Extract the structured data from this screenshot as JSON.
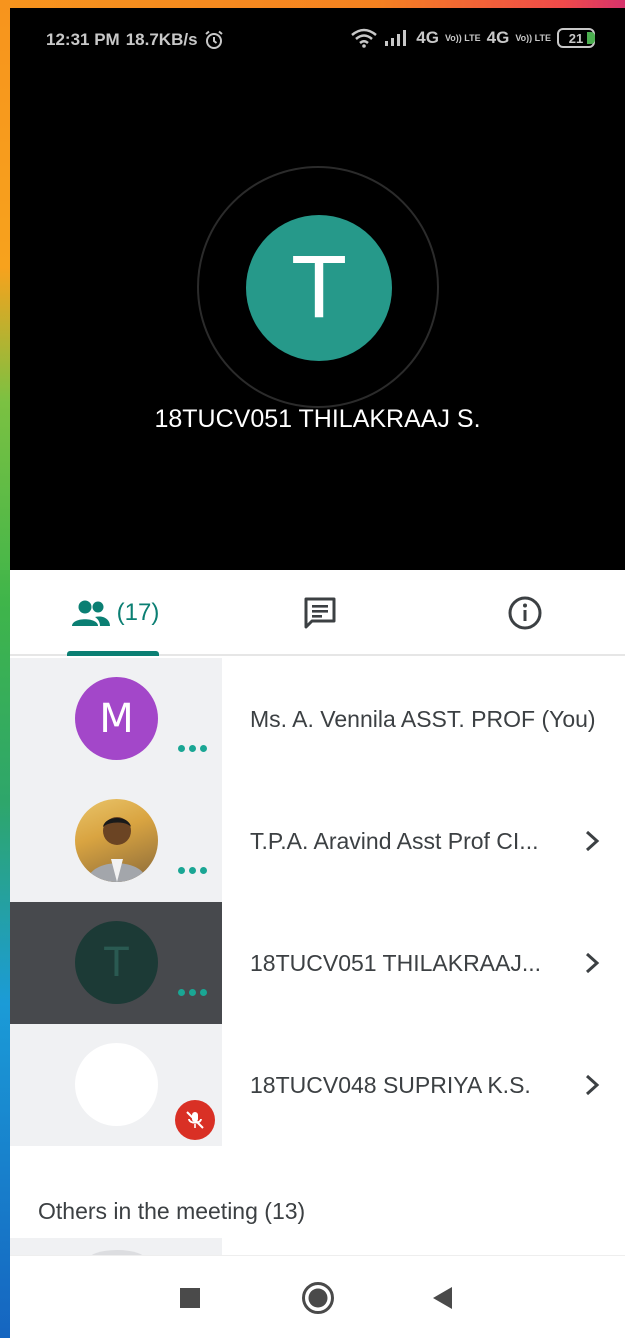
{
  "status_bar": {
    "time": "12:31 PM",
    "speed": "18.7KB/s",
    "net1": "4G",
    "net2": "4G",
    "volte": "Vo)) LTE",
    "battery": "21"
  },
  "main_speaker": {
    "initial": "T",
    "name": "18TUCV051 THILAKRAAJ S.",
    "avatar_color": "#26998a"
  },
  "tabs": {
    "people_count": "(17)",
    "people_icon": "people-icon",
    "chat_icon": "chat-icon",
    "info_icon": "info-icon",
    "accent": "#0b7f73"
  },
  "participants": [
    {
      "initial": "M",
      "name": "Ms. A. Vennila ASST. PROF (You)",
      "avatar": "purple",
      "status": "speaking-dots"
    },
    {
      "initial": "",
      "name": "T.P.A. Aravind Asst Prof CI...",
      "avatar": "photo",
      "status": "speaking-dots"
    },
    {
      "initial": "T",
      "name": "18TUCV051 THILAKRAAJ...",
      "avatar": "dark",
      "status": "speaking-dots"
    },
    {
      "initial": "",
      "name": "18TUCV048 SUPRIYA K.S.",
      "avatar": "white",
      "status": "muted"
    }
  ],
  "others": {
    "label": "Others in the meeting (13)"
  },
  "navbar": {
    "recents_icon": "square-icon",
    "home_icon": "circle-icon",
    "back_icon": "back-triangle-icon"
  }
}
